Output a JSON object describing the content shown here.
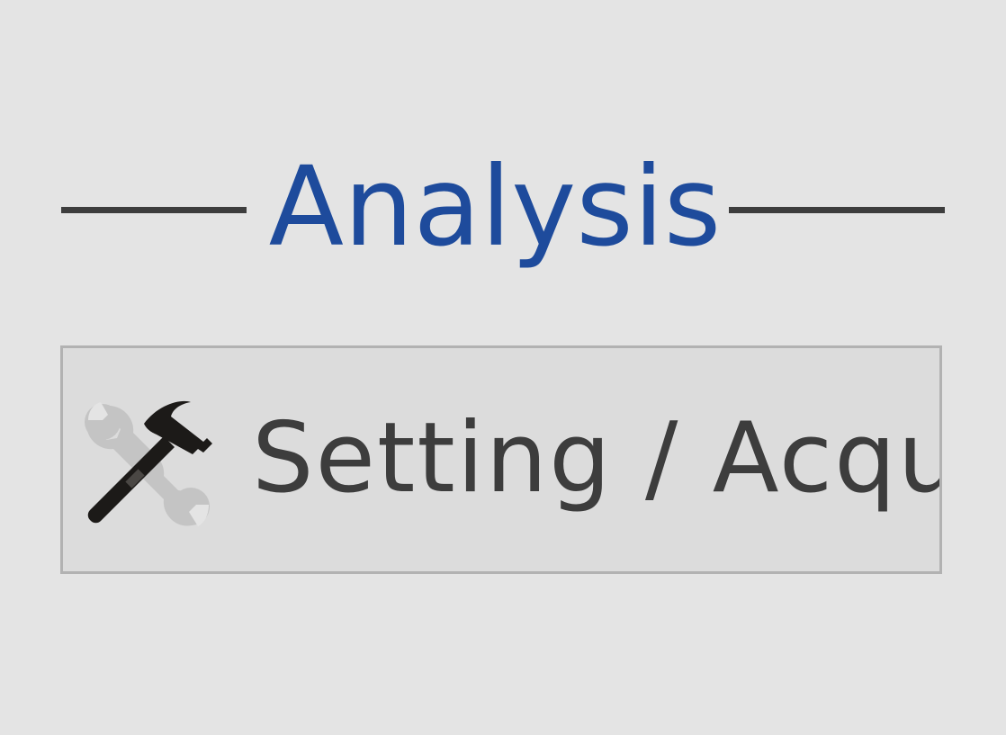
{
  "section": {
    "title": "Analysis"
  },
  "action_button": {
    "label": "Setting / Acqui",
    "icon": "hammer-wrench-icon"
  },
  "colors": {
    "background": "#e4e4e4",
    "title": "#1e4b9c",
    "rule": "#3d3d3d",
    "button_background": "#dcdcdc",
    "button_border": "#b2b2b2",
    "button_text": "#3d3d3d"
  }
}
